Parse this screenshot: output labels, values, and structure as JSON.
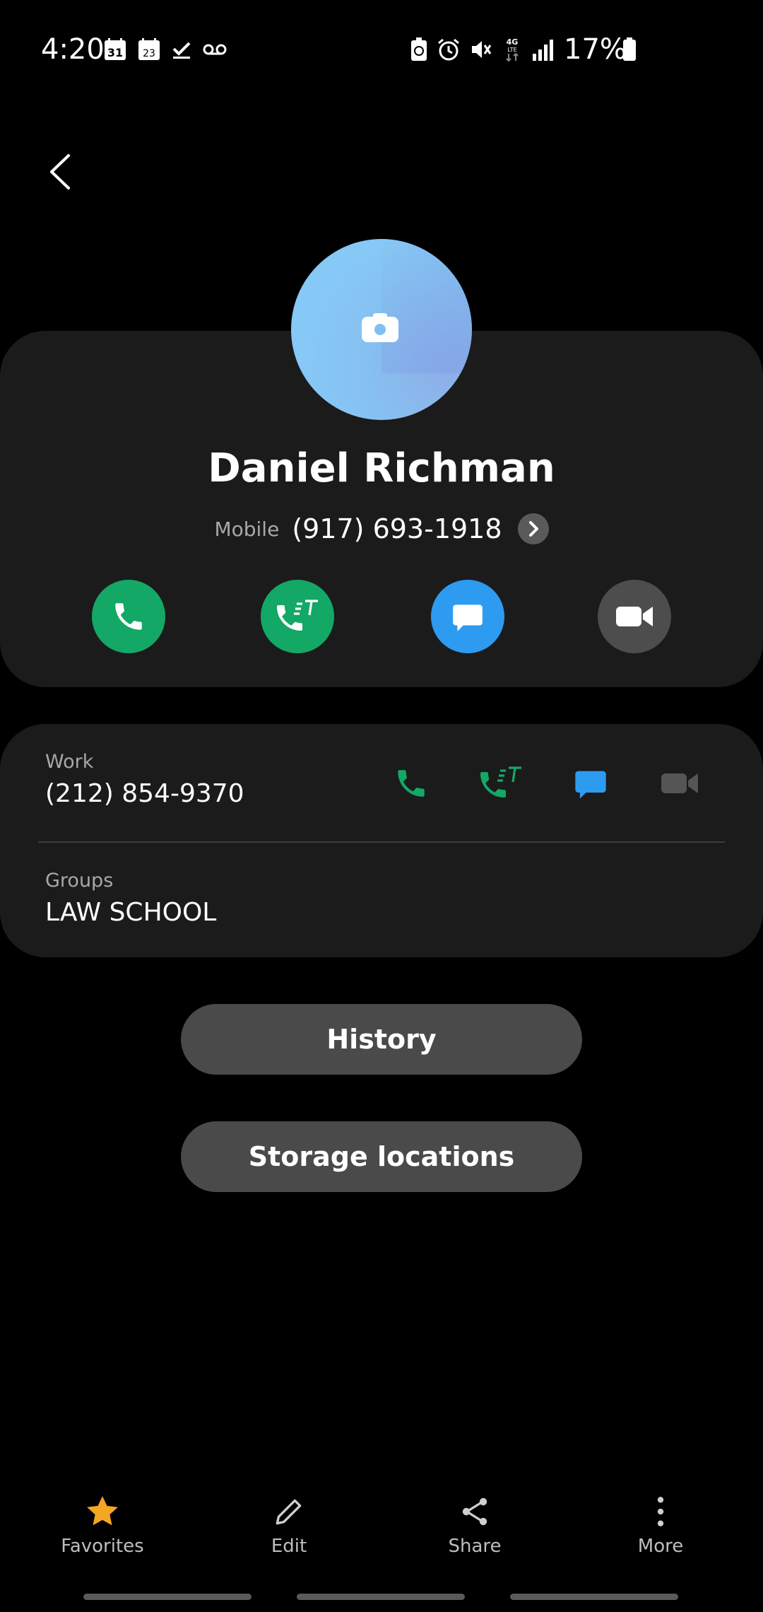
{
  "status_bar": {
    "time": "4:20",
    "battery": "17%",
    "left_icons": [
      "calendar-31-icon",
      "calendar-23-icon",
      "checkmark-icon",
      "voicemail-icon"
    ],
    "right_icons": [
      "battery-saver-icon",
      "alarm-icon",
      "mute-icon",
      "4g-lte-icon",
      "signal-icon",
      "battery-icon"
    ]
  },
  "contact": {
    "name": "Daniel Richman",
    "mobile_label": "Mobile",
    "mobile_number": "(917) 693-1918"
  },
  "actions": [
    "call-icon",
    "rtt-call-icon",
    "message-icon",
    "video-call-icon"
  ],
  "info": {
    "work_label": "Work",
    "work_number": "(212) 854-9370",
    "groups_label": "Groups",
    "groups_value": "LAW SCHOOL"
  },
  "buttons": {
    "history": "History",
    "storage": "Storage locations"
  },
  "bottom_nav": {
    "favorites": "Favorites",
    "edit": "Edit",
    "share": "Share",
    "more": "More"
  },
  "colors": {
    "green": "#13a866",
    "blue": "#2d9bf0",
    "gray_button": "#4d4d4d",
    "card": "#1b1b1b",
    "star": "#f5a623"
  }
}
